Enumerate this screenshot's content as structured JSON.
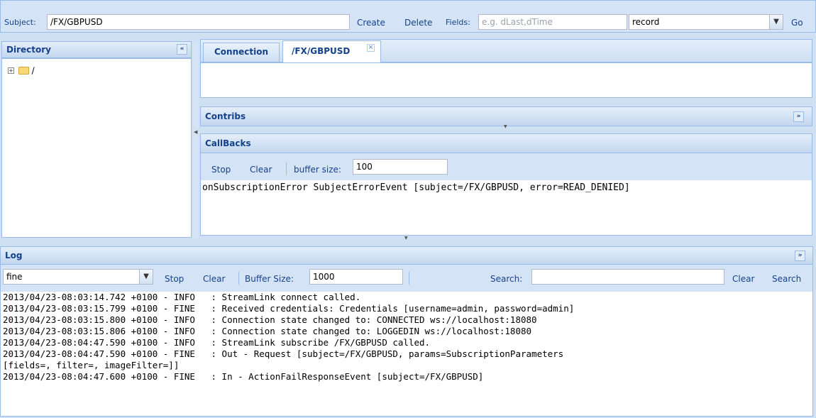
{
  "toolbar": {
    "subject_label": "Subject:",
    "subject_value": "/FX/GBPUSD",
    "create": "Create",
    "delete": "Delete",
    "fields_label": "Fields:",
    "fields_placeholder": "e.g. dLast,dTime",
    "record_type": "record",
    "go": "Go"
  },
  "directory": {
    "title": "Directory",
    "collapse_icon": "double-chevron-left",
    "tree_root": "/"
  },
  "tabs": [
    {
      "label": "Connection",
      "active": false
    },
    {
      "label": "/FX/GBPUSD",
      "active": true,
      "closable": true
    }
  ],
  "contribs": {
    "title": "Contribs"
  },
  "callbacks": {
    "title": "CallBacks",
    "stop": "Stop",
    "clear": "Clear",
    "buffer_label": "buffer size:",
    "buffer_value": "100",
    "output": "onSubscriptionError SubjectErrorEvent [subject=/FX/GBPUSD, error=READ_DENIED]"
  },
  "log": {
    "title": "Log",
    "level": "fine",
    "stop": "Stop",
    "clear": "Clear",
    "buffer_label": "Buffer Size:",
    "buffer_value": "1000",
    "search_label": "Search:",
    "search_value": "",
    "clear2": "Clear",
    "search_button": "Search",
    "lines": [
      "2013/04/23-08:03:14.742 +0100 - INFO   : StreamLink connect called.",
      "2013/04/23-08:03:15.799 +0100 - FINE   : Received credentials: Credentials [username=admin, password=admin]",
      "2013/04/23-08:03:15.800 +0100 - INFO   : Connection state changed to: CONNECTED ws://localhost:18080",
      "2013/04/23-08:03:15.806 +0100 - INFO   : Connection state changed to: LOGGEDIN ws://localhost:18080",
      "2013/04/23-08:04:47.590 +0100 - INFO   : StreamLink subscribe /FX/GBPUSD called.",
      "2013/04/23-08:04:47.590 +0100 - FINE   : Out - Request [subject=/FX/GBPUSD, params=SubscriptionParameters",
      "[fields=, filter=, imageFilter=]]",
      "2013/04/23-08:04:47.600 +0100 - FINE   : In - ActionFailResponseEvent [subject=/FX/GBPUSD]"
    ]
  },
  "colors": {
    "accent": "#15428b",
    "border": "#99bbe8",
    "background": "#cfe0f3"
  }
}
